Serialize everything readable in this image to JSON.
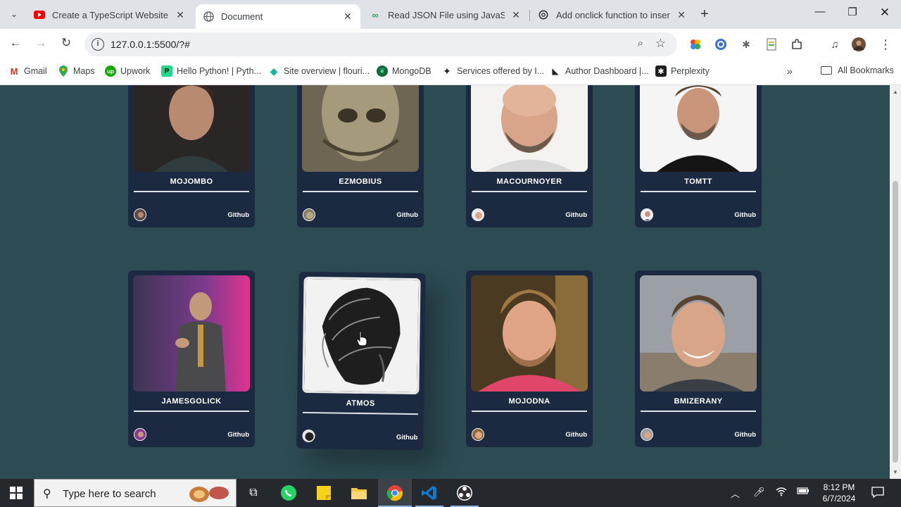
{
  "browser": {
    "tabs": [
      {
        "title": "Create a TypeScript Website wi",
        "icon": "youtube-icon",
        "active": false
      },
      {
        "title": "Document",
        "icon": "globe-icon",
        "active": true
      },
      {
        "title": "Read JSON File using JavaScript",
        "icon": "infinity-icon",
        "active": false
      },
      {
        "title": "Add onclick function to insertA",
        "icon": "openai-icon",
        "active": false
      }
    ],
    "address": "127.0.0.1:5500/?#",
    "bookmarks": [
      {
        "label": "Gmail",
        "icon": "gmail-icon",
        "color": "#d93025",
        "glyph": "M"
      },
      {
        "label": "Maps",
        "icon": "maps-icon",
        "color": "#34a853",
        "glyph": "●"
      },
      {
        "label": "Upwork",
        "icon": "upwork-icon",
        "color": "#14a800",
        "glyph": "up"
      },
      {
        "label": "Hello Python! | Pyth...",
        "icon": "pycharm-icon",
        "color": "#21d789",
        "glyph": "P"
      },
      {
        "label": "Site overview | flouri...",
        "icon": "diamond-icon",
        "color": "#12b5a5",
        "glyph": "◆"
      },
      {
        "label": "MongoDB",
        "icon": "mongodb-icon",
        "color": "#0a6b3a",
        "glyph": "●"
      },
      {
        "label": "Services offered by I...",
        "icon": "star-burst-icon",
        "color": "#222222",
        "glyph": "✦"
      },
      {
        "label": "Author Dashboard |...",
        "icon": "author-icon",
        "color": "#222222",
        "glyph": "▲"
      },
      {
        "label": "Perplexity",
        "icon": "perplexity-icon",
        "color": "#1f1f1f",
        "glyph": "✱"
      }
    ],
    "all_bookmarks": "All Bookmarks"
  },
  "cards": [
    {
      "username": "MOJOMBO",
      "link": "Github"
    },
    {
      "username": "EZMOBIUS",
      "link": "Github"
    },
    {
      "username": "MACOURNOYER",
      "link": "Github"
    },
    {
      "username": "TOMTT",
      "link": "Github"
    },
    {
      "username": "JAMESGOLICK",
      "link": "Github"
    },
    {
      "username": "ATMOS",
      "link": "Github"
    },
    {
      "username": "MOJODNA",
      "link": "Github"
    },
    {
      "username": "BMIZERANY",
      "link": "Github"
    }
  ],
  "taskbar": {
    "search_placeholder": "Type here to search",
    "time": "8:12 PM",
    "date": "6/7/2024"
  },
  "colors": {
    "page_bg": "#2c4b52",
    "card_bg": "#1b2a41",
    "divider": "#dfe4ea"
  }
}
